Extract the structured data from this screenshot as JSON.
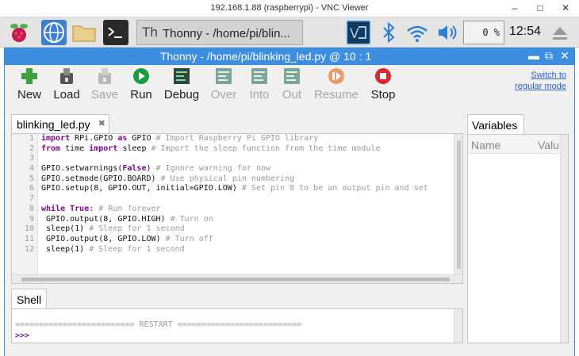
{
  "vnc": {
    "title": "192.168.1.88 (raspberrypi) - VNC Viewer",
    "minimize": "–",
    "maximize": "□",
    "close": "✕"
  },
  "taskbar": {
    "task_label": "Thonny  -  /home/pi/blin...",
    "cpu": "0 %",
    "clock": "12:54",
    "icons": [
      "raspberry-menu-icon",
      "web-browser-icon",
      "file-manager-icon",
      "terminal-icon",
      "vnc-icon",
      "bluetooth-icon",
      "wifi-icon",
      "volume-icon",
      "eject-icon"
    ]
  },
  "window": {
    "title": "Thonny  -  /home/pi/blinking_led.py  @  10 : 1",
    "minimize": "▬",
    "maximize": "⧉",
    "close": "✕"
  },
  "toolbar": {
    "items": [
      {
        "label": "New",
        "state": "enabled",
        "color": "#3fa142"
      },
      {
        "label": "Load",
        "state": "enabled",
        "color": "#444444"
      },
      {
        "label": "Save",
        "state": "disabled",
        "color": "#a6a6a6"
      },
      {
        "label": "Run",
        "state": "enabled",
        "color": "#1c9b3f"
      },
      {
        "label": "Debug",
        "state": "enabled",
        "color": "#2f6b4c"
      },
      {
        "label": "Over",
        "state": "disabled",
        "color": "#7fa59a"
      },
      {
        "label": "Into",
        "state": "disabled",
        "color": "#7fa59a"
      },
      {
        "label": "Out",
        "state": "disabled",
        "color": "#7fa59a"
      },
      {
        "label": "Resume",
        "state": "disabled",
        "color": "#e59a6e"
      },
      {
        "label": "Stop",
        "state": "enabled",
        "color": "#d9272e"
      }
    ],
    "switch_line1": "Switch to",
    "switch_line2": "regular mode"
  },
  "editor": {
    "tab_label": "blinking_led.py",
    "tab_close": "✖",
    "line_numbers": [
      "1",
      "2",
      "3",
      "4",
      "5",
      "6",
      "7",
      "8",
      "9",
      "10",
      "11",
      "12"
    ],
    "lines": [
      [
        {
          "t": "import",
          "k": "kw"
        },
        {
          "t": " RPi.GPIO ",
          "k": ""
        },
        {
          "t": "as",
          "k": "kw"
        },
        {
          "t": " GPIO ",
          "k": ""
        },
        {
          "t": "# Import Raspberry Pi GPIO library",
          "k": "cm"
        }
      ],
      [
        {
          "t": "from",
          "k": "kw"
        },
        {
          "t": " time ",
          "k": ""
        },
        {
          "t": "import",
          "k": "kw"
        },
        {
          "t": " sleep ",
          "k": ""
        },
        {
          "t": "# Import the sleep function from the time module",
          "k": "cm"
        }
      ],
      [],
      [
        {
          "t": "GPIO.setwarnings(",
          "k": ""
        },
        {
          "t": "False",
          "k": "kw"
        },
        {
          "t": ") ",
          "k": ""
        },
        {
          "t": "# Ignore warning for now",
          "k": "cm"
        }
      ],
      [
        {
          "t": "GPIO.setmode(GPIO.BOARD) ",
          "k": ""
        },
        {
          "t": "# Use physical pin numbering",
          "k": "cm"
        }
      ],
      [
        {
          "t": "GPIO.setup(8, GPIO.OUT, initial=GPIO.LOW) ",
          "k": ""
        },
        {
          "t": "# Set pin 8 to be an output pin and set",
          "k": "cm"
        }
      ],
      [],
      [
        {
          "t": "while",
          "k": "kw"
        },
        {
          "t": " ",
          "k": ""
        },
        {
          "t": "True",
          "k": "kw"
        },
        {
          "t": ": ",
          "k": ""
        },
        {
          "t": "# Run forever",
          "k": "cm"
        }
      ],
      [
        {
          "t": " GPIO.output(8, GPIO.HIGH) ",
          "k": ""
        },
        {
          "t": "# Turn on",
          "k": "cm"
        }
      ],
      [
        {
          "t": " sleep(1) ",
          "k": ""
        },
        {
          "t": "# Sleep for 1 second",
          "k": "cm"
        }
      ],
      [
        {
          "t": " GPIO.output(8, GPIO.LOW) ",
          "k": ""
        },
        {
          "t": "# Turn off",
          "k": "cm"
        }
      ],
      [
        {
          "t": " sleep(1) ",
          "k": ""
        },
        {
          "t": "# Sleep for 1 second",
          "k": "cm"
        }
      ]
    ]
  },
  "shell": {
    "tab_label": "Shell",
    "restart_line": "========================= RESTART ==========================",
    "prompt": ">>>"
  },
  "variables": {
    "tab_label": "Variables",
    "col_name": "Name",
    "col_value": "Valu"
  }
}
